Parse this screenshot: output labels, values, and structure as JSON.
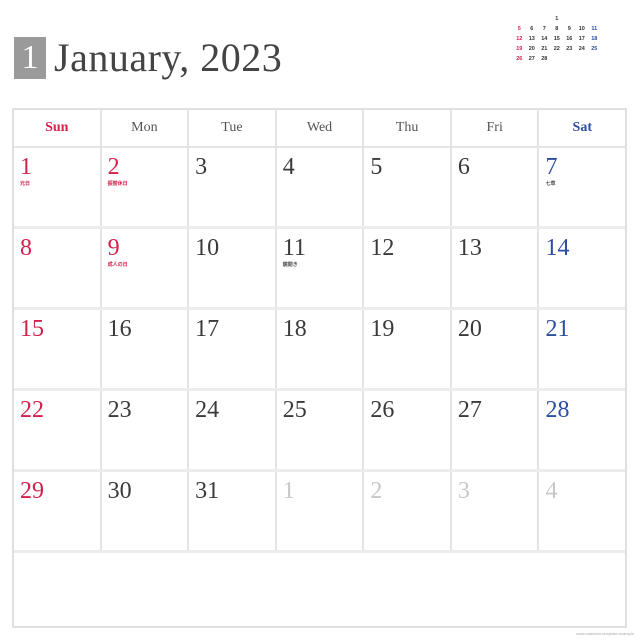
{
  "header": {
    "month_number": "1",
    "title": "January, 2023"
  },
  "mini_calendar": {
    "rows": [
      [
        "",
        "",
        "",
        "1",
        "",
        "",
        ""
      ],
      [
        "5",
        "6",
        "7",
        "8",
        "9",
        "10",
        "11"
      ],
      [
        "12",
        "13",
        "14",
        "15",
        "16",
        "17",
        "18"
      ],
      [
        "19",
        "20",
        "21",
        "22",
        "23",
        "24",
        "25"
      ],
      [
        "26",
        "27",
        "28",
        "",
        "",
        "",
        ""
      ]
    ]
  },
  "weekdays": [
    "Sun",
    "Mon",
    "Tue",
    "Wed",
    "Thu",
    "Fri",
    "Sat"
  ],
  "weeks": [
    [
      {
        "num": "1",
        "note": "元日",
        "kind": "sun"
      },
      {
        "num": "2",
        "note": "振替休日",
        "kind": "hol"
      },
      {
        "num": "3",
        "note": "",
        "kind": ""
      },
      {
        "num": "4",
        "note": "",
        "kind": ""
      },
      {
        "num": "5",
        "note": "",
        "kind": ""
      },
      {
        "num": "6",
        "note": "",
        "kind": ""
      },
      {
        "num": "7",
        "note": "七草",
        "kind": "sat",
        "note_plain": true
      }
    ],
    [
      {
        "num": "8",
        "note": "",
        "kind": "sun"
      },
      {
        "num": "9",
        "note": "成人の日",
        "kind": "hol"
      },
      {
        "num": "10",
        "note": "",
        "kind": ""
      },
      {
        "num": "11",
        "note": "鏡開き",
        "kind": "",
        "note_plain": true
      },
      {
        "num": "12",
        "note": "",
        "kind": ""
      },
      {
        "num": "13",
        "note": "",
        "kind": ""
      },
      {
        "num": "14",
        "note": "",
        "kind": "sat"
      }
    ],
    [
      {
        "num": "15",
        "note": "",
        "kind": "sun"
      },
      {
        "num": "16",
        "note": "",
        "kind": ""
      },
      {
        "num": "17",
        "note": "",
        "kind": ""
      },
      {
        "num": "18",
        "note": "",
        "kind": ""
      },
      {
        "num": "19",
        "note": "",
        "kind": ""
      },
      {
        "num": "20",
        "note": "",
        "kind": ""
      },
      {
        "num": "21",
        "note": "",
        "kind": "sat"
      }
    ],
    [
      {
        "num": "22",
        "note": "",
        "kind": "sun"
      },
      {
        "num": "23",
        "note": "",
        "kind": ""
      },
      {
        "num": "24",
        "note": "",
        "kind": ""
      },
      {
        "num": "25",
        "note": "",
        "kind": ""
      },
      {
        "num": "26",
        "note": "",
        "kind": ""
      },
      {
        "num": "27",
        "note": "",
        "kind": ""
      },
      {
        "num": "28",
        "note": "",
        "kind": "sat"
      }
    ],
    [
      {
        "num": "29",
        "note": "",
        "kind": "sun"
      },
      {
        "num": "30",
        "note": "",
        "kind": ""
      },
      {
        "num": "31",
        "note": "",
        "kind": ""
      },
      {
        "num": "1",
        "note": "",
        "kind": "other"
      },
      {
        "num": "2",
        "note": "",
        "kind": "other"
      },
      {
        "num": "3",
        "note": "",
        "kind": "other"
      },
      {
        "num": "4",
        "note": "",
        "kind": "other"
      }
    ]
  ],
  "colors": {
    "sunday": "#d4204c",
    "saturday": "#2c4ea0",
    "other_month": "#c8c8c8",
    "month_badge": "#9a9a9a"
  },
  "footer": {
    "credit": "www.calendar-template.example"
  }
}
